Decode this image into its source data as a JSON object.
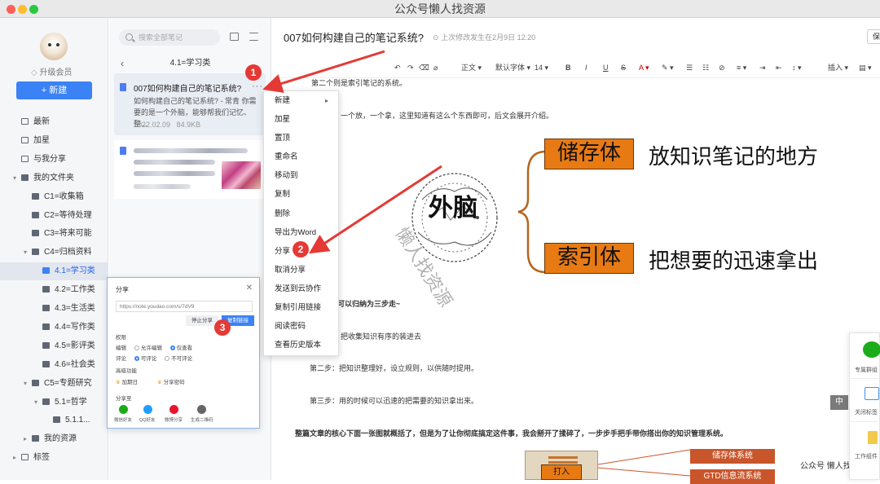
{
  "window": {
    "title": "公众号懒人找资源"
  },
  "sidebar": {
    "vip_label": "升级会员",
    "new_button": "+ 新建",
    "items": [
      {
        "label": "最新",
        "icon": "grid-icon",
        "indent": 0,
        "expand": ""
      },
      {
        "label": "加星",
        "icon": "star-icon",
        "indent": 0,
        "expand": ""
      },
      {
        "label": "与我分享",
        "icon": "share-icon",
        "indent": 0,
        "expand": ""
      },
      {
        "label": "我的文件夹",
        "icon": "folder-icon",
        "indent": 0,
        "expand": "▾"
      },
      {
        "label": "C1=收集箱",
        "icon": "folder-icon",
        "indent": 1,
        "expand": ""
      },
      {
        "label": "C2=等待处理",
        "icon": "folder-icon",
        "indent": 1,
        "expand": ""
      },
      {
        "label": "C3=将来可能",
        "icon": "folder-icon",
        "indent": 1,
        "expand": ""
      },
      {
        "label": "C4=归档资料",
        "icon": "folder-icon",
        "indent": 1,
        "expand": "▾"
      },
      {
        "label": "4.1=学习类",
        "icon": "folder-icon",
        "indent": 2,
        "expand": "",
        "active": true
      },
      {
        "label": "4.2=工作类",
        "icon": "folder-icon",
        "indent": 2,
        "expand": ""
      },
      {
        "label": "4.3=生活类",
        "icon": "folder-icon",
        "indent": 2,
        "expand": ""
      },
      {
        "label": "4.4=写作类",
        "icon": "folder-icon",
        "indent": 2,
        "expand": ""
      },
      {
        "label": "4.5=影评类",
        "icon": "folder-icon",
        "indent": 2,
        "expand": ""
      },
      {
        "label": "4.6=社会类",
        "icon": "folder-icon",
        "indent": 2,
        "expand": ""
      },
      {
        "label": "C5=专题研究",
        "icon": "folder-icon",
        "indent": 1,
        "expand": "▾"
      },
      {
        "label": "5.1=哲学",
        "icon": "folder-icon",
        "indent": 2,
        "expand": "▾"
      },
      {
        "label": "5.1.1...",
        "icon": "folder-icon",
        "indent": 3,
        "expand": ""
      },
      {
        "label": "我的资源",
        "icon": "folder-icon",
        "indent": 1,
        "expand": "▸"
      },
      {
        "label": "标签",
        "icon": "tag-icon",
        "indent": 0,
        "expand": "▸"
      }
    ]
  },
  "notelist": {
    "search_placeholder": "搜索全部笔记",
    "folder_title": "4.1=学习类",
    "note1": {
      "title": "007如何构建自己的笔记系统?",
      "snippet": "如何构建自己的笔记系统? - 常青 你需要的是一个外脑，能够帮我们记忆、整...",
      "date": "2022.02.09",
      "size": "84.9KB"
    }
  },
  "context_menu": {
    "items": [
      "新建",
      "加星",
      "置顶",
      "重命名",
      "移动到",
      "复制",
      "删除",
      "导出为Word",
      "分享",
      "取消分享",
      "发送到云协作",
      "复制引用链接",
      "阅读密码",
      "查看历史版本"
    ]
  },
  "share_dialog": {
    "title": "分享",
    "url": "https://note.youdao.com/s/7dV9",
    "stop_button": "停止分享",
    "copy_button": "复制链接",
    "perm_label": "权限",
    "edit_label": "编辑",
    "edit_opt1": "允许编辑",
    "edit_opt2": "仅查看",
    "comment_label": "评论",
    "comment_opt1": "可评论",
    "comment_opt2": "不可评论",
    "advanced_label": "高级功能",
    "adv_opt1": "加期日",
    "adv_opt2": "分享密码",
    "share_to_label": "分享至",
    "targets": [
      "微信好友",
      "QQ好友",
      "微博分享",
      "生成二维码"
    ]
  },
  "editor": {
    "title": "007如何构建自己的笔记系统?",
    "saved_status": "上次修改发生在2月9日 12:20",
    "save_button": "保",
    "toolbar": {
      "style": "正文",
      "font": "默认字体",
      "size": "14",
      "insert": "插入"
    },
    "lines": [
      "第二个则是索引笔记的系统。",
      "一个放，一个拿，这里知道有这么个东西即可，后文会展开介绍。",
      "搭建可以归纳为三步走~",
      "把收集知识有序的装进去",
      "第二步：把知识整理好，设立规则，以供随时提用。",
      "第三步：用的时候可以迅速的把需要的知识拿出来。",
      "整篇文章的核心下面一张图就概括了，但是为了让你彻底搞定这件事，我会掰开了揉碎了，一步步手把手带你搭出你的知识管理系统。"
    ],
    "diagram": {
      "center": "外脑",
      "box1": "储存体",
      "text1": "放知识笔记的地方",
      "box2": "索引体",
      "text2": "把想要的迅速拿出",
      "watermark": "懒人找资源"
    },
    "bottom_diagram": {
      "left": "打入",
      "right1": "储存体系统",
      "right2": "GTD信息流系统"
    },
    "float_panel": [
      "专属群组",
      "关闭标签",
      "工作组件"
    ],
    "ime": "中",
    "watermark": "公众号 懒人找资源"
  },
  "annotations": [
    "1",
    "2",
    "3"
  ]
}
